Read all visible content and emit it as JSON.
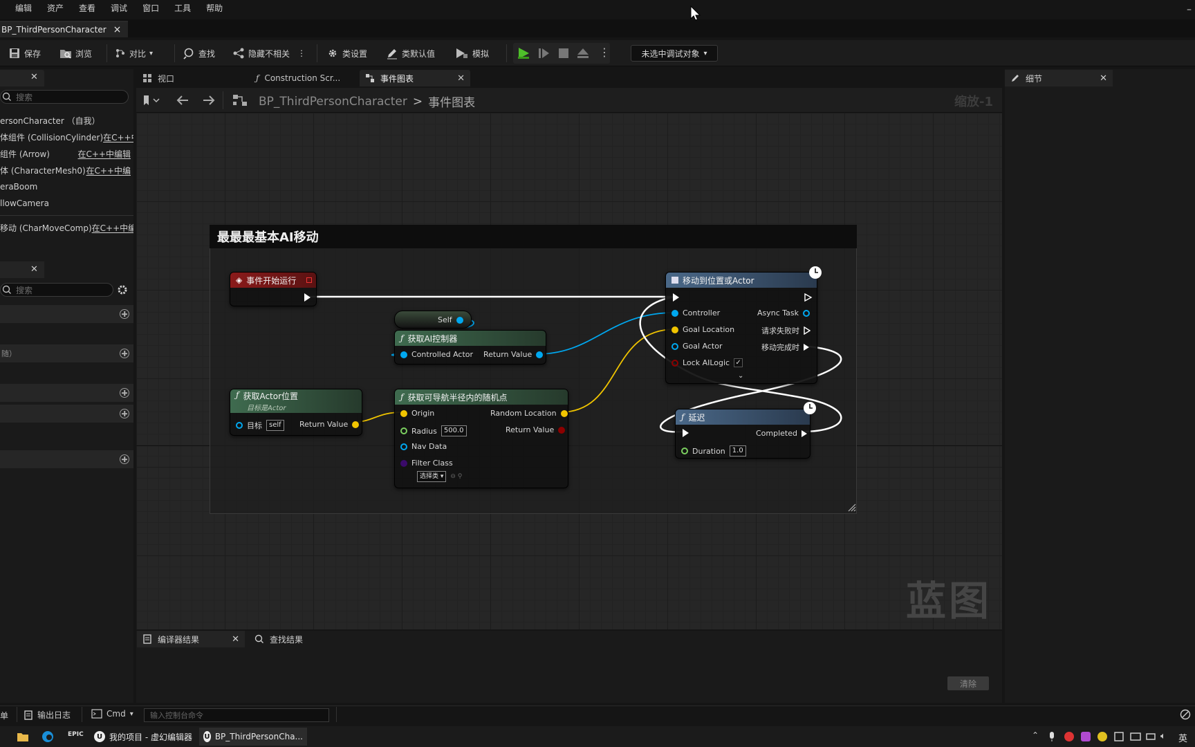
{
  "menu": [
    "编辑",
    "资产",
    "查看",
    "调试",
    "窗口",
    "工具",
    "帮助"
  ],
  "document_tab": {
    "title": "BP_ThirdPersonCharacter",
    "close": "×"
  },
  "toolbar": {
    "save": "保存",
    "browse": "浏览",
    "diff": "对比",
    "find": "查找",
    "hide_unrelated": "隐藏不相关",
    "class_settings": "类设置",
    "class_defaults": "类默认值",
    "simulate": "模拟",
    "debug_target": "未选中调试对象"
  },
  "left_panel": {
    "search_placeholder": "搜索",
    "components": [
      {
        "name": "ersonCharacter （自我）",
        "link": ""
      },
      {
        "name": "体组件 (CollisionCylinder)",
        "link": "在C++中"
      },
      {
        "name": "组件 (Arrow)",
        "link": "在C++中编辑"
      },
      {
        "name": "体 (CharacterMesh0)",
        "link": "在C++中编"
      },
      {
        "name": "eraBoom",
        "link": ""
      },
      {
        "name": "llowCamera",
        "link": ""
      },
      {
        "name": "移动 (CharMoveComp)",
        "link": "在C++中编"
      }
    ],
    "search2_placeholder": "搜索",
    "category_hint": "随）"
  },
  "center_tabs": [
    {
      "label": "视口"
    },
    {
      "label": "Construction Scr..."
    },
    {
      "label": "事件图表"
    }
  ],
  "breadcrumb": {
    "root": "BP_ThirdPersonCharacter",
    "sep": ">",
    "leaf": "事件图表",
    "zoom": "缩放-1"
  },
  "comment": {
    "title": "最最最基本AI移动"
  },
  "nodes": {
    "begin_play": {
      "title": "事件开始运行"
    },
    "self": {
      "label": "Self"
    },
    "get_ai_controller": {
      "title": "获取AI控制器",
      "in": "Controlled Actor",
      "out": "Return Value"
    },
    "get_actor_location": {
      "title": "获取Actor位置",
      "subtitle": "目标是Actor",
      "target": "目标",
      "target_val": "self",
      "out": "Return Value"
    },
    "random_point": {
      "title": "获取可导航半径内的随机点",
      "origin": "Origin",
      "radius": "Radius",
      "radius_val": "500.0",
      "nav": "Nav Data",
      "filter": "Filter Class",
      "filter_val": "选择类",
      "out1": "Random Location",
      "out2": "Return Value"
    },
    "move_to": {
      "title": "移动到位置或Actor",
      "controller": "Controller",
      "goal_loc": "Goal Location",
      "goal_actor": "Goal Actor",
      "lock": "Lock AILogic",
      "async": "Async Task",
      "fail": "请求失败时",
      "success": "移动完成时"
    },
    "delay": {
      "title": "延迟",
      "completed": "Completed",
      "duration": "Duration",
      "duration_val": "1.0"
    }
  },
  "watermark": "蓝图",
  "details_tab": "细节",
  "bottom_tabs": {
    "compiler": "编译器结果",
    "find": "查找结果",
    "clear": "清除"
  },
  "statusbar": {
    "left": "单",
    "output_log": "输出日志",
    "cmd": "Cmd",
    "console_placeholder": "输入控制台命令"
  },
  "taskbar": {
    "item1": "我的项目 - 虚幻编辑器",
    "item2": "BP_ThirdPersonCha...",
    "ime": "英"
  },
  "colors": {
    "exec": "#ffffff",
    "object": "#00a8f0",
    "vector": "#f0c400",
    "float": "#7cd060",
    "bool": "#8c0000",
    "class": "#5a00b0",
    "event_header": "#8a1a1a",
    "func_header": "#3f6b4f",
    "latent_header": "#3e5a72"
  }
}
